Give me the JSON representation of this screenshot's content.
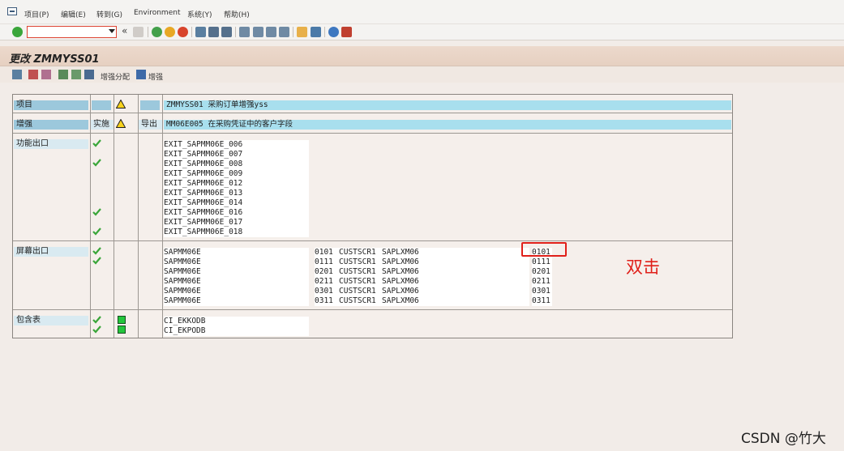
{
  "menu": {
    "items": [
      "项目(P)",
      "编辑(E)",
      "转到(G)",
      "Environment",
      "系统(Y)",
      "帮助(H)"
    ]
  },
  "toolbar": {
    "command_field": "",
    "collapse_label": "«",
    "icons": [
      "enter-icon",
      "save-icon",
      "back-icon",
      "exit-icon",
      "cancel-icon",
      "print-icon",
      "find-icon",
      "find-next-icon",
      "first-page-icon",
      "prev-page-icon",
      "next-page-icon",
      "last-page-icon",
      "new-session-icon",
      "shortcut-icon",
      "help-icon",
      "layout-icon"
    ]
  },
  "title": "更改 ZMMYSS01",
  "app_toolbar": {
    "assign_label": "增强分配",
    "enhance_label": "增强"
  },
  "rows": {
    "project": {
      "label": "项目",
      "value": "ZMMYSS01 采购订单增强yss"
    },
    "enhancement": {
      "label": "增强",
      "status": "实施",
      "dir": "导出",
      "value": "MM06E005 在采购凭证中的客户字段"
    },
    "function_exits": {
      "label": "功能出口",
      "items": [
        "EXIT_SAPMM06E_006",
        "EXIT_SAPMM06E_007",
        "EXIT_SAPMM06E_008",
        "EXIT_SAPMM06E_009",
        "EXIT_SAPMM06E_012",
        "EXIT_SAPMM06E_013",
        "EXIT_SAPMM06E_014",
        "EXIT_SAPMM06E_016",
        "EXIT_SAPMM06E_017",
        "EXIT_SAPMM06E_018"
      ]
    },
    "screen_exits": {
      "label": "屏幕出口",
      "items": [
        {
          "prog": "SAPMM06E",
          "dynpro": "0101",
          "area": "CUSTSCR1",
          "called": "SAPLXM06",
          "sub": "0101"
        },
        {
          "prog": "SAPMM06E",
          "dynpro": "0111",
          "area": "CUSTSCR1",
          "called": "SAPLXM06",
          "sub": "0111"
        },
        {
          "prog": "SAPMM06E",
          "dynpro": "0201",
          "area": "CUSTSCR1",
          "called": "SAPLXM06",
          "sub": "0201"
        },
        {
          "prog": "SAPMM06E",
          "dynpro": "0211",
          "area": "CUSTSCR1",
          "called": "SAPLXM06",
          "sub": "0211"
        },
        {
          "prog": "SAPMM06E",
          "dynpro": "0301",
          "area": "CUSTSCR1",
          "called": "SAPLXM06",
          "sub": "0301"
        },
        {
          "prog": "SAPMM06E",
          "dynpro": "0311",
          "area": "CUSTSCR1",
          "called": "SAPLXM06",
          "sub": "0311"
        }
      ]
    },
    "includes": {
      "label": "包含表",
      "items": [
        "CI_EKKODB",
        "CI_EKPODB"
      ]
    }
  },
  "annotation": "双击",
  "watermark": "CSDN @竹大",
  "colors": {
    "header_blue": "#9cc8dc",
    "value_cyan": "#a8dfee",
    "check_green": "#3aa63a",
    "annotation_red": "#e0201a"
  }
}
